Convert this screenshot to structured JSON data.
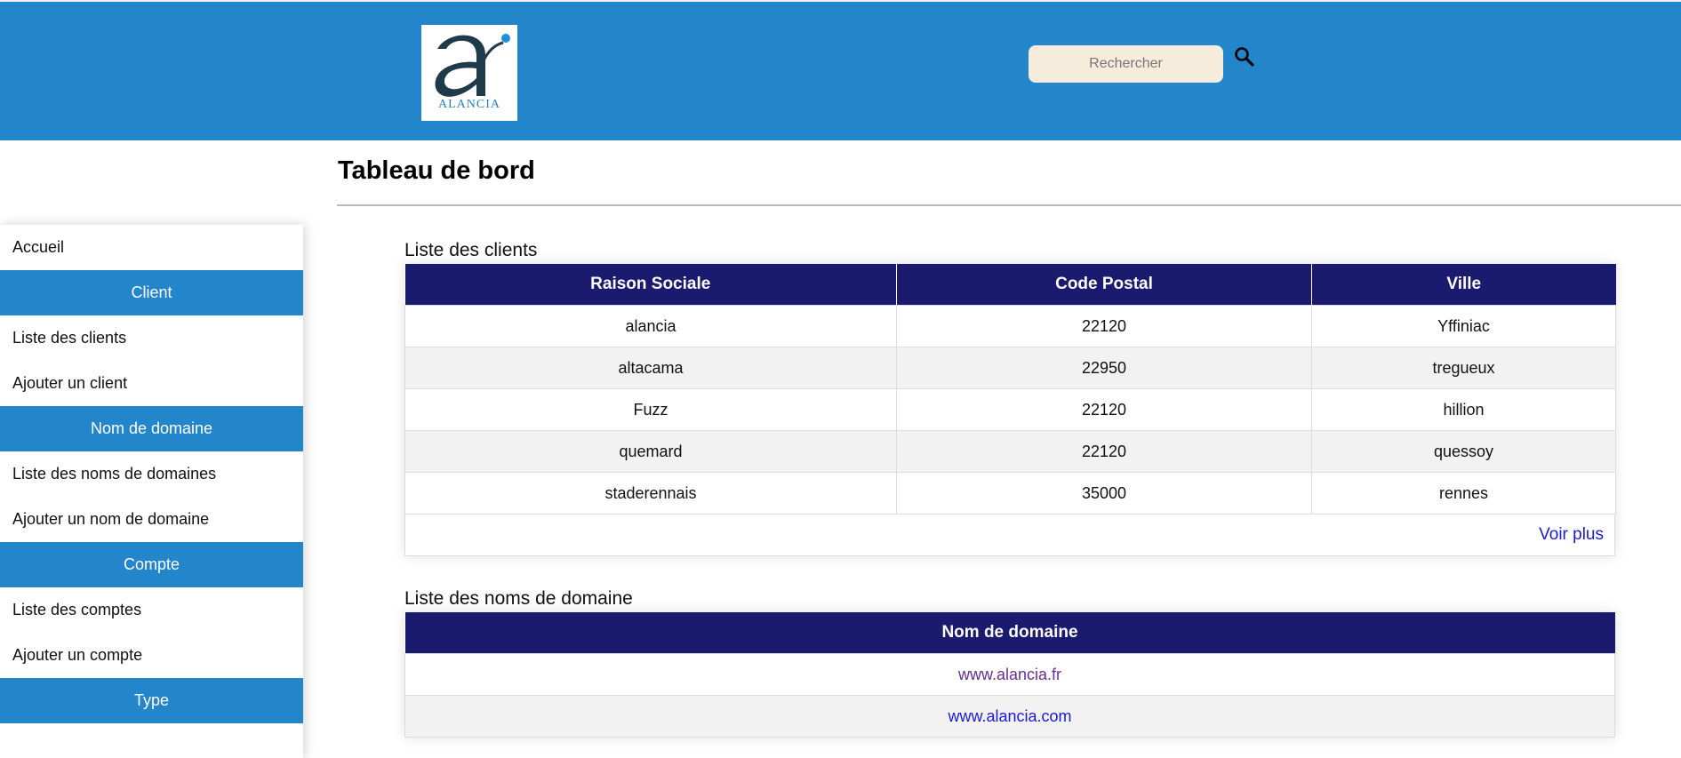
{
  "header": {
    "logo_text": "ALANCIA",
    "search": {
      "placeholder": "Rechercher"
    },
    "icons": {
      "search": "search-icon"
    },
    "colors": {
      "header_bg": "#2386cb",
      "search_bg": "#f5ecdc"
    }
  },
  "page": {
    "title": "Tableau de bord"
  },
  "sidebar": {
    "home": "Accueil",
    "sections": [
      {
        "title": "Client",
        "items": [
          "Liste des clients",
          "Ajouter un client"
        ]
      },
      {
        "title": "Nom de domaine",
        "items": [
          "Liste des noms de domaines",
          "Ajouter un nom de domaine"
        ]
      },
      {
        "title": "Compte",
        "items": [
          "Liste des comptes",
          "Ajouter un compte"
        ]
      },
      {
        "title": "Type",
        "items": []
      }
    ]
  },
  "clients": {
    "title": "Liste des clients",
    "columns": [
      "Raison Sociale",
      "Code Postal",
      "Ville"
    ],
    "rows": [
      [
        "alancia",
        "22120",
        "Yffiniac"
      ],
      [
        "altacama",
        "22950",
        "tregueux"
      ],
      [
        "Fuzz",
        "22120",
        "hillion"
      ],
      [
        "quemard",
        "22120",
        "quessoy"
      ],
      [
        "staderennais",
        "35000",
        "rennes"
      ]
    ],
    "more_label": "Voir plus"
  },
  "domains": {
    "title": "Liste des noms de domaine",
    "columns": [
      "Nom de domaine"
    ],
    "rows": [
      "www.alancia.fr",
      "www.alancia.com"
    ]
  },
  "colors": {
    "table_header": "#1a1a6f",
    "link": "#1a1ad6",
    "visited_link": "#6a2e96"
  }
}
